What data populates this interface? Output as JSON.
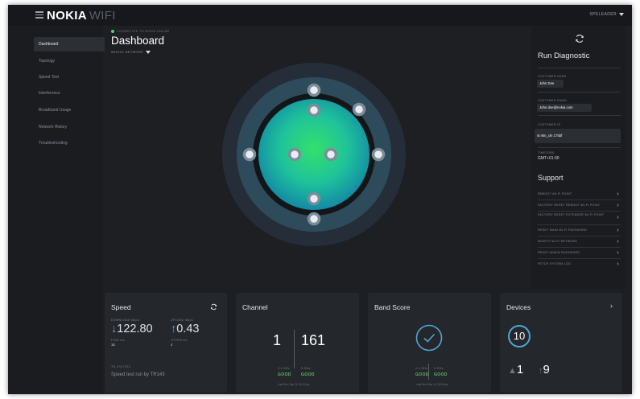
{
  "brand": {
    "main": "NOKIA",
    "sub": "WIFI"
  },
  "user_menu": {
    "label": "SPELEADER"
  },
  "sidebar": {
    "items": [
      {
        "label": "Dashboard",
        "active": true
      },
      {
        "label": "Topology"
      },
      {
        "label": "Speed Test"
      },
      {
        "label": "Interference"
      },
      {
        "label": "Broadband Usage"
      },
      {
        "label": "Network History"
      },
      {
        "label": "Troubleshooting"
      }
    ]
  },
  "main": {
    "status": "CONNECTED TO NOKIA ONLINE",
    "title": "Dashboard",
    "network_select": "WHOLE NETWORK"
  },
  "colors": {
    "accent": "#4fa6d8",
    "good": "#5dbb63",
    "status_dot": "#3ddc84"
  },
  "right_panel": {
    "diagnostic_title": "Run Diagnostic",
    "customer_name_label": "CUSTOMER NAME",
    "customer_name": "John Doe",
    "customer_email_label": "CUSTOMER EMAIL",
    "customer_email": "John.doe@nokia.com",
    "customer_id_label": "CUSTOMER ID",
    "customer_id": "st nkn_cln 175bf",
    "timezone_label": "TIMEZONE",
    "timezone": "GMT+01:00",
    "support_title": "Support",
    "support_items": [
      "REBOOT WI-FI POINT",
      "FACTORY RESET REBOOT WI-FI POINT",
      "FACTORY RESET EXTENDER WI-FI POINT",
      "RESET MAIN WI-FI PASSWORD",
      "MODIFY WI-FI NETWORK",
      "RESET ADMIN PASSWORD",
      "FETCH SYSTEM LOG"
    ]
  },
  "speed": {
    "title": "Speed",
    "download_label": "DOWNLOAD Mbps",
    "download_arrow": "↓",
    "download": "122.80",
    "upload_label": "UPLOAD Mbps",
    "upload_arrow": "↑",
    "upload": "0.43",
    "ping_label": "PING ms",
    "ping": "18",
    "jitter_label": "JITTER ms",
    "jitter": "4",
    "ran_label": "TR-178 ITEX",
    "run_text": "Speed test run by TR143"
  },
  "channel": {
    "title": "Channel",
    "ch24": "1",
    "ch5": "161",
    "label24": "2.4 GHz",
    "label5": "5 GHz",
    "good24": "GOOD",
    "good5": "GOOD",
    "last_run": "Last Run: Sep 11, 09:15 pm"
  },
  "band": {
    "title": "Band Score",
    "label24": "2.4 GHz",
    "label5": "5 GHz",
    "good24": "GOOD",
    "good5": "GOOD",
    "last_run": "Last Run: Sep 11, 09:15 pm"
  },
  "devices": {
    "title": "Devices",
    "total": "10",
    "down_arrow": "▲",
    "down": "1",
    "up_arrow": "↑",
    "up": "9"
  }
}
